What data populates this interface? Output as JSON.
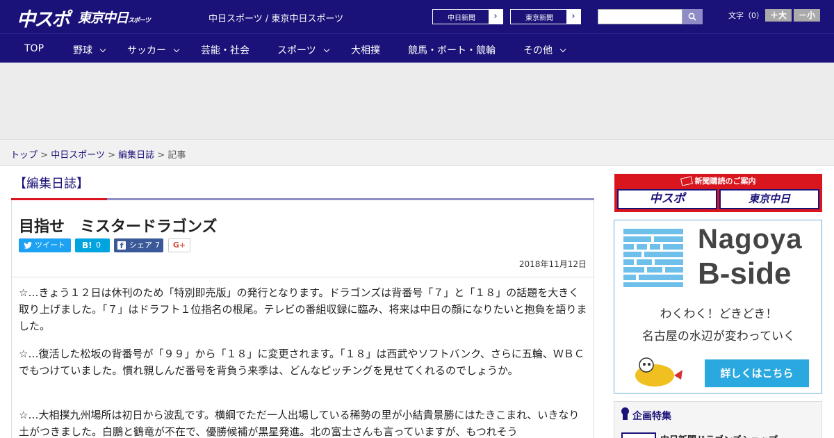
{
  "header": {
    "logo_chuspo": "中スポ",
    "logo_tokyo": "東京中日",
    "logo_tokyo_sub": "スポーツ",
    "tagline": "中日スポーツ / 東京中日スポーツ",
    "site_buttons": [
      "中日新聞",
      "東京新聞"
    ],
    "search_placeholder": "",
    "font_size_label": "文字（0）",
    "font_bigger": "＋大",
    "font_smaller": "－小"
  },
  "nav": {
    "items": [
      {
        "label": "TOP"
      },
      {
        "label": "野球"
      },
      {
        "label": "サッカー"
      },
      {
        "label": "芸能・社会"
      },
      {
        "label": "スポーツ"
      },
      {
        "label": "大相撲"
      },
      {
        "label": "競馬・ボート・競輪"
      },
      {
        "label": "その他"
      }
    ]
  },
  "breadcrumb": {
    "items": [
      "トップ",
      "中日スポーツ",
      "編集日誌"
    ],
    "current": "記事",
    "separator": ">"
  },
  "section": {
    "title": "【編集日誌】"
  },
  "article": {
    "headline": "目指せ　ミスタードラゴンズ",
    "share": {
      "tweet": "ツイート",
      "hatena_count": "0",
      "facebook": "シェア",
      "facebook_count": "7",
      "gplus": "G+"
    },
    "date": "2018年11月12日",
    "paragraphs": [
      "☆…きょう１２日は休刊のため「特別即売版」の発行となります。ドラゴンズは背番号「７」と「１８」の話題を大きく取り上げました。「７」はドラフト１位指名の根尾。テレビの番組収録に臨み、将来は中日の顔になりたいと抱負を語りました。",
      "☆…復活した松坂の背番号が「９９」から「１８」に変更されます。「１８」は西武やソフトバンク、さらに五輪、ＷＢＣでもつけていました。慣れ親しんだ番号を背負う来季は、どんなピッチングを見せてくれるのでしょうか。",
      "☆…大相撲九州場所は初日から波乱です。横綱でただ一人出場している稀勢の里が小結貴景勝にはたきこまれ、いきなり土がつきました。白鵬と鶴竜が不在で、優勝候補が黒星発進。北の富士さんも言っていますが、もつれそう"
    ]
  },
  "sidebar": {
    "subscription_title": "新聞購読のご案内",
    "subscription_logos": [
      "中スポ",
      "東京中日"
    ],
    "banner": {
      "line1": "Nagoya",
      "line2": "B-side",
      "copy1": "わくわく！どきどき！",
      "copy2": "名古屋の水辺が変わっていく",
      "button": "詳しくはこちら"
    },
    "feature_title": "企画特集",
    "feature_item": "中日新聞ドラゴンズショップ"
  },
  "colors": {
    "brand_navy": "#1a1278",
    "accent_red": "#d9151d",
    "twitter": "#1da1f2",
    "hatena": "#00a4de",
    "facebook": "#3b5998",
    "banner_blue": "#2aa8e0"
  }
}
